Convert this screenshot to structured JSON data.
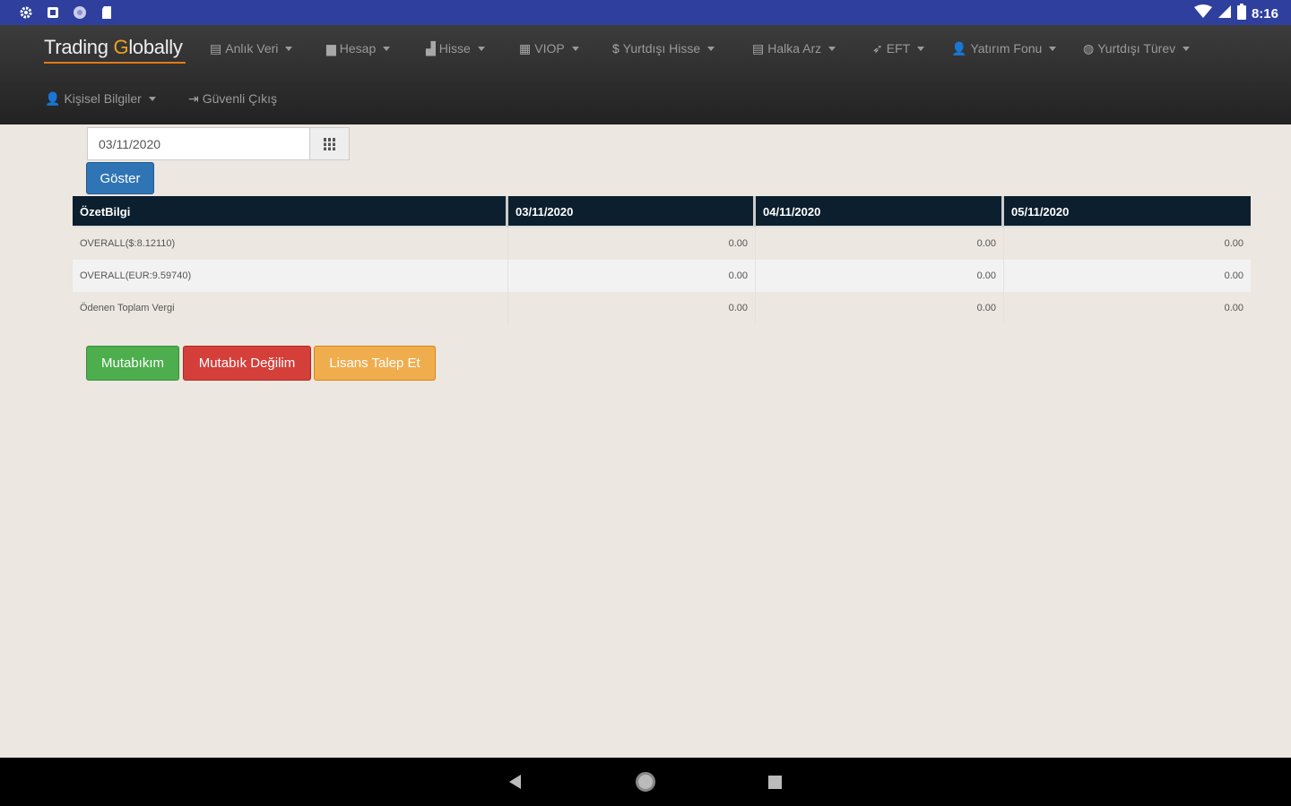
{
  "status_bar": {
    "time": "8:16",
    "icons": [
      "settings-icon",
      "app-icon",
      "globe-icon",
      "sd-card-icon",
      "wifi-icon",
      "signal-icon",
      "battery-icon"
    ]
  },
  "navbar": {
    "brand": {
      "part1": "Trading ",
      "part2": "G",
      "part3": "lobally"
    },
    "row1": [
      {
        "label": "Anlık Veri",
        "icon": "list-icon"
      },
      {
        "label": "Hesap",
        "icon": "briefcase-icon"
      },
      {
        "label": "Hisse",
        "icon": "stats-icon"
      },
      {
        "label": "VIOP",
        "icon": "calendar-icon"
      },
      {
        "label": "Yurtdışı Hisse",
        "icon": "dollar-icon"
      },
      {
        "label": "Halka Arz",
        "icon": "list-icon"
      },
      {
        "label": "EFT",
        "icon": "send-icon"
      },
      {
        "label": "Yatırım Fonu",
        "icon": "user-icon"
      },
      {
        "label": "Yurtdışı Türev",
        "icon": "globe-icon"
      }
    ],
    "row2": [
      {
        "label": "Kişisel Bilgiler",
        "icon": "user-icon",
        "caret": true
      },
      {
        "label": "Güvenli Çıkış",
        "icon": "logout-icon",
        "caret": false
      }
    ]
  },
  "form": {
    "date_value": "03/11/2020",
    "show_button": "Göster"
  },
  "table": {
    "headers": [
      "ÖzetBilgi",
      "03/11/2020",
      "04/11/2020",
      "05/11/2020"
    ],
    "rows": [
      [
        "OVERALL($:8.12110)",
        "0.00",
        "0.00",
        "0.00"
      ],
      [
        "OVERALL(EUR:9.59740)",
        "0.00",
        "0.00",
        "0.00"
      ],
      [
        "Ödenen Toplam Vergi",
        "0.00",
        "0.00",
        "0.00"
      ]
    ]
  },
  "actions": {
    "agree": "Mutabıkım",
    "disagree": "Mutabık Değilim",
    "license": "Lisans Talep Et"
  },
  "colors": {
    "status_bar": "#2f3f9e",
    "brand_accent": "#e07b18",
    "primary": "#2f74b5",
    "success": "#4cae4c",
    "danger": "#d43f3a",
    "warning": "#f0ad4e",
    "table_header": "#0b1f2e"
  }
}
